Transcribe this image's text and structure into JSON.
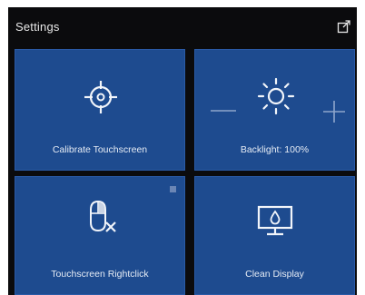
{
  "window": {
    "title": "Settings",
    "popout_icon": "open-in-new-window-icon"
  },
  "tiles": {
    "calibrate": {
      "label": "Calibrate Touchscreen",
      "icon": "crosshair-target-icon"
    },
    "backlight": {
      "label": "Backlight: 100%",
      "icon": "sun-brightness-icon",
      "level_percent": 100,
      "decrease_icon": "minus-icon",
      "increase_icon": "plus-icon"
    },
    "rightclick": {
      "label": "Touchscreen Rightclick",
      "icon": "mouse-disabled-icon"
    },
    "clean": {
      "label": "Clean Display",
      "icon": "monitor-droplet-icon"
    }
  },
  "colors": {
    "window_bg": "#0b0b0d",
    "tile_bg": "#1e4b8f",
    "text": "#e6ecf5"
  }
}
